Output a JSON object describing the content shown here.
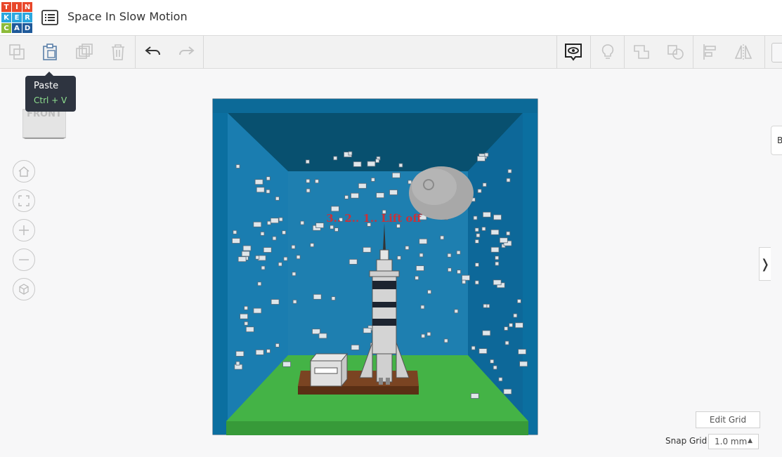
{
  "app": {
    "logo_letters": [
      "T",
      "I",
      "N",
      "K",
      "E",
      "R",
      "C",
      "A",
      "D"
    ],
    "logo_colors": [
      "#e8472a",
      "#e8472a",
      "#e8472a",
      "#2aa7df",
      "#2aa7df",
      "#2aa7df",
      "#8dbb3a",
      "#1f5a9a",
      "#1f5a9a"
    ],
    "title": "Space In Slow Motion"
  },
  "toolbar": {
    "tooltip": {
      "label": "Paste",
      "shortcut": "Ctrl + V"
    }
  },
  "viewcube": {
    "face_label": "FRONT"
  },
  "scene": {
    "banner_text": "3.. 2.. 1.. Lift off"
  },
  "right_panel": {
    "tab_letter": "B",
    "collapse_glyph": "❭"
  },
  "grid": {
    "edit_label": "Edit Grid",
    "snap_label": "Snap Grid",
    "snap_value": "1.0 mm",
    "snap_caret": "▲"
  },
  "colors": {
    "box_blue": "#0b6fa0",
    "box_dark": "#084766",
    "floor_green": "#44b346",
    "base_brown": "#6b3b1a",
    "banner_red": "#c8323a"
  }
}
